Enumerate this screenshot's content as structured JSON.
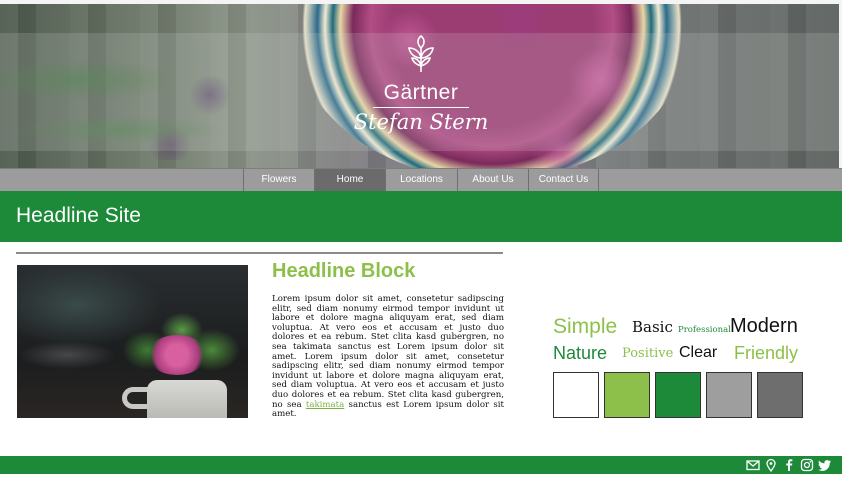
{
  "brand": {
    "name": "Gärtner",
    "subtitle": "Stefan Stern"
  },
  "nav": {
    "items": [
      {
        "label": "Flowers",
        "active": false
      },
      {
        "label": "Home",
        "active": true
      },
      {
        "label": "Locations",
        "active": false
      },
      {
        "label": "About Us",
        "active": false
      },
      {
        "label": "Contact Us",
        "active": false
      }
    ]
  },
  "headline": {
    "site": "Headline Site",
    "block": "Headline Block"
  },
  "body": {
    "text_before_link": "Lorem ipsum dolor sit amet, consetetur sadipscing elitr, sed diam nonumy eirmod tempor invidunt ut labore et dolore magna aliquyam erat, sed diam voluptua. At vero eos et accusam et justo duo dolores et ea rebum. Stet clita kasd gubergren, no sea takimata sanctus est Lorem ipsum dolor sit amet. Lorem ipsum dolor sit amet, consetetur sadipscing elitr, sed diam nonumy eirmod tempor invidunt ut labore et dolore magna aliquyam erat, sed diam voluptua. At vero eos et accusam et justo duo dolores et ea rebum. Stet clita kasd gubergren, no sea ",
    "link": "takimata",
    "text_after_link": " sanctus est Lorem ipsum dolor sit amet."
  },
  "wordcloud": {
    "words": [
      {
        "text": "Simple",
        "color": "#8dc04a"
      },
      {
        "text": "Basic",
        "color": "#111111"
      },
      {
        "text": "Professional",
        "color": "#1d8a3a"
      },
      {
        "text": "Modern",
        "color": "#111111"
      },
      {
        "text": "Nature",
        "color": "#1d8a3a"
      },
      {
        "text": "Positive",
        "color": "#8dc04a"
      },
      {
        "text": "Clear",
        "color": "#111111"
      },
      {
        "text": "Friendly",
        "color": "#8dc04a"
      }
    ]
  },
  "palette": [
    "#ffffff",
    "#8dc04a",
    "#1d8a3a",
    "#9e9e9e",
    "#6e6e6e"
  ],
  "colors": {
    "primary_green": "#1d8a3a",
    "accent_green": "#8dc04a",
    "nav_gray": "#9c9c9c",
    "nav_active": "#6b6b6b"
  },
  "footer": {
    "icons": [
      "mail-icon",
      "location-pin-icon",
      "facebook-icon",
      "instagram-icon",
      "twitter-icon"
    ]
  }
}
